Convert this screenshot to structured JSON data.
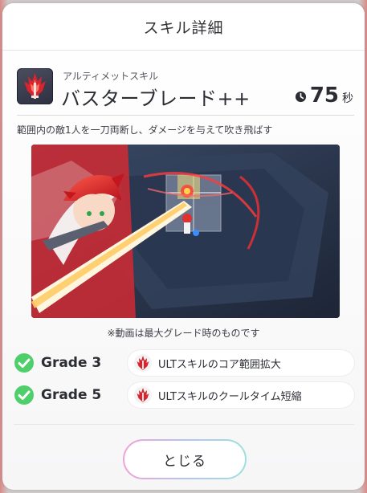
{
  "modal": {
    "title": "スキル詳細"
  },
  "skill": {
    "type": "アルティメットスキル",
    "name": "バスターブレード++",
    "cooldown_value": "75",
    "cooldown_unit": "秒",
    "description": "範囲内の敵1人を一刀両断し、ダメージを与えて吹き飛ばす"
  },
  "video": {
    "note": "※動画は最大グレード時のものです"
  },
  "grades": [
    {
      "label": "Grade 3",
      "text": "ULTスキルのコア範囲拡大"
    },
    {
      "label": "Grade 5",
      "text": "ULTスキルのクールタイム短縮"
    }
  ],
  "close_button": {
    "label": "とじる"
  },
  "colors": {
    "check": "#4fcf6b",
    "flame": "#d8242e",
    "close_gradient_start": "#f2a2d2",
    "close_gradient_end": "#9ee0dc"
  },
  "icons": {
    "skill": "red-flame-sword-icon",
    "clock": "clock-icon",
    "check": "check-circle-icon",
    "grade": "red-flame-icon"
  }
}
